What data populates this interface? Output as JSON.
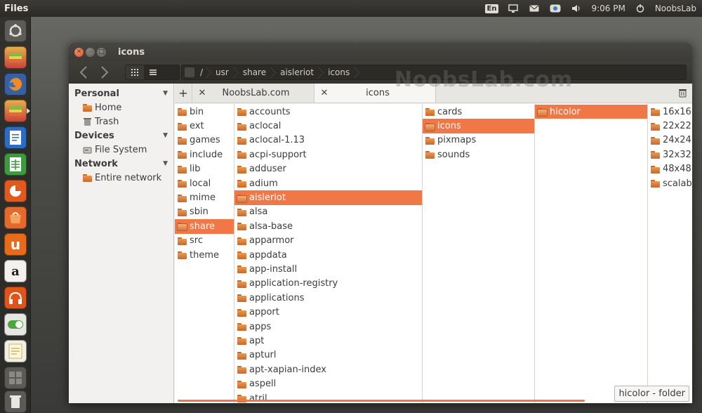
{
  "top_panel": {
    "app_name": "Files",
    "keyboard_layout": "En",
    "icons": [
      "display-icon",
      "mail-icon",
      "messaging-icon",
      "volume-icon"
    ],
    "clock": "9:06 PM",
    "user": "NoobsLab"
  },
  "launcher": {
    "items": [
      "ubuntu-logo-icon",
      "files-icon",
      "firefox-icon",
      "files-icon-active",
      "writer-icon",
      "calc-icon",
      "ubuntu-one-icon",
      "software-center-icon",
      "ubuntu-one-music-icon",
      "amazon-icon",
      "synaptic-toggle-icon",
      "notes-icon",
      "workspace-switcher-icon",
      "trash-icon"
    ]
  },
  "window": {
    "title": "icons",
    "path": [
      "/",
      "usr",
      "share",
      "aisleriot",
      "icons"
    ]
  },
  "sidebar": {
    "sections": [
      {
        "heading": "Personal",
        "items": [
          "Home",
          "Trash"
        ]
      },
      {
        "heading": "Devices",
        "items": [
          "File System"
        ]
      },
      {
        "heading": "Network",
        "items": [
          "Entire network"
        ]
      }
    ]
  },
  "tabs": [
    {
      "label": "NoobsLab.com",
      "active": false
    },
    {
      "label": "icons",
      "active": true
    }
  ],
  "columns": [
    {
      "items": [
        "bin",
        "ext",
        "games",
        "include",
        "lib",
        "local",
        "mime",
        "sbin",
        "share",
        "src",
        "theme"
      ],
      "selected": "share"
    },
    {
      "items": [
        "accounts",
        "aclocal",
        "aclocal-1.13",
        "acpi-support",
        "adduser",
        "adium",
        "aisleriot",
        "alsa",
        "alsa-base",
        "apparmor",
        "appdata",
        "app-install",
        "application-registry",
        "applications",
        "apport",
        "apps",
        "apt",
        "apturl",
        "apt-xapian-index",
        "aspell",
        "atril"
      ],
      "selected": "aisleriot"
    },
    {
      "items": [
        "cards",
        "icons",
        "pixmaps",
        "sounds"
      ],
      "selected": "icons"
    },
    {
      "items": [
        "hicolor"
      ],
      "selected": "hicolor"
    },
    {
      "items": [
        "16x16",
        "22x22",
        "24x24",
        "32x32",
        "48x48",
        "scalabl"
      ],
      "selected": ""
    }
  ],
  "status_tip": "hicolor - folder",
  "watermark": "NoobsLab.com",
  "colors": {
    "selection": "#f07746",
    "panel": "#3c3b37",
    "folder": "#d9823f"
  }
}
